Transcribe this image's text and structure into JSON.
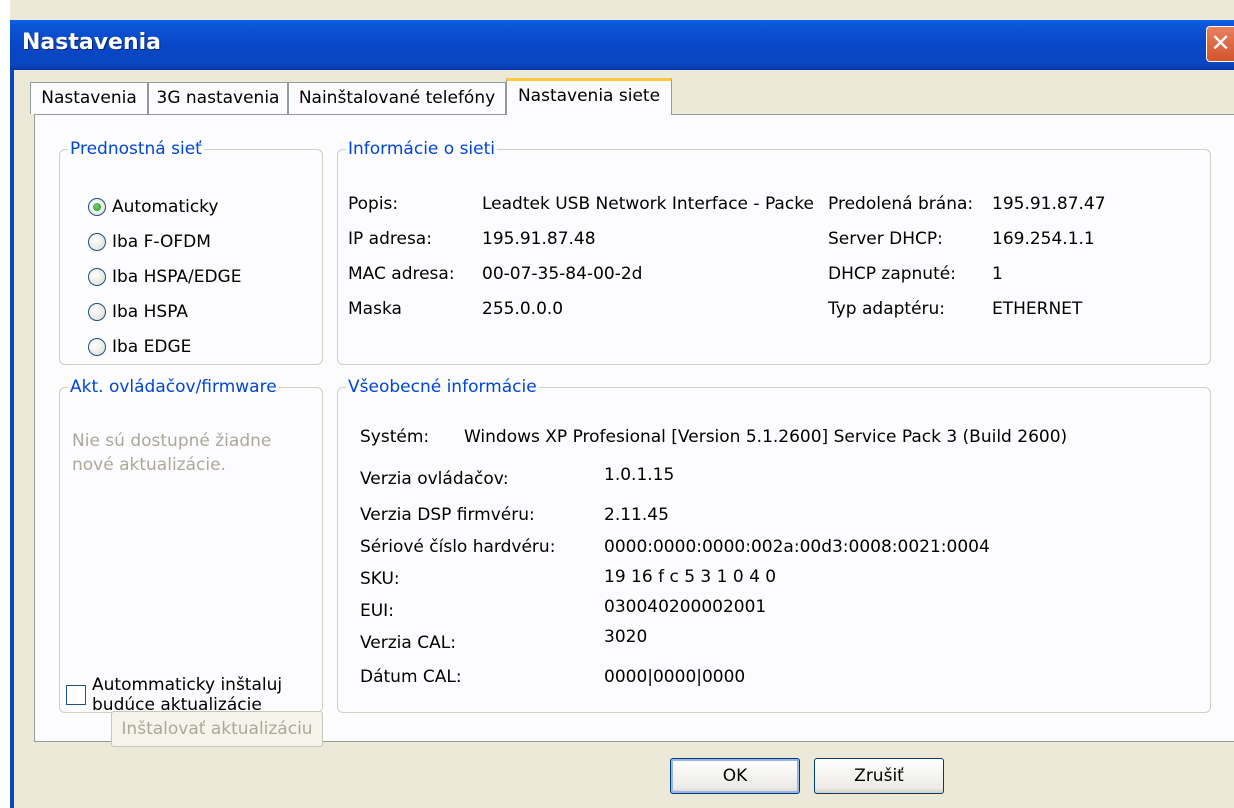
{
  "window": {
    "title": "Nastavenia"
  },
  "tabs": [
    {
      "label": "Nastavenia"
    },
    {
      "label": "3G nastavenia"
    },
    {
      "label": "Nainštalované telefóny"
    },
    {
      "label": "Nastavenia siete"
    }
  ],
  "preferred_network": {
    "legend": "Prednostná sieť",
    "selected": "Automaticky",
    "options": [
      "Automaticky",
      "Iba F-OFDM",
      "Iba HSPA/EDGE",
      "Iba HSPA",
      "Iba EDGE"
    ]
  },
  "network_info": {
    "legend": "Informácie o sieti",
    "left": [
      {
        "label": "Popis:",
        "value": "Leadtek USB Network Interface - Packe"
      },
      {
        "label": "IP adresa:",
        "value": "195.91.87.48"
      },
      {
        "label": "MAC adresa:",
        "value": "00-07-35-84-00-2d"
      },
      {
        "label": "Maska",
        "value": "255.0.0.0"
      }
    ],
    "right": [
      {
        "label": "Predolená brána:",
        "value": "195.91.87.47"
      },
      {
        "label": "Server DHCP:",
        "value": "169.254.1.1"
      },
      {
        "label": "DHCP zapnuté:",
        "value": "1"
      },
      {
        "label": "Typ adaptéru:",
        "value": "ETHERNET"
      }
    ]
  },
  "firmware": {
    "legend": "Akt. ovládačov/firmware",
    "status_line1": "Nie sú dostupné žiadne",
    "status_line2": "nové aktualizácie.",
    "install_button": "Inštalovať aktualizáciu",
    "auto_install_line1": "Autommaticky inštaluj",
    "auto_install_line2": "budúce aktualizácie",
    "auto_install_checked": false
  },
  "general_info": {
    "legend": "Všeobecné informácie",
    "system_label": "Systém:",
    "system_value": "Windows XP Profesional [Version 5.1.2600] Service Pack 3 (Build 2600)",
    "rows": [
      {
        "label": "Verzia ovládačov:",
        "value": "1.0.1.15"
      },
      {
        "label": "Verzia DSP firmvéru:",
        "value": "2.11.45"
      },
      {
        "label": "Sériové číslo hardvéru:",
        "value": "0000:0000:0000:002a:00d3:0008:0021:0004"
      },
      {
        "label": "SKU:",
        "value": "19 16 f c 5 3 1 0 4 0"
      },
      {
        "label": "EUI:",
        "value": "030040200002001"
      },
      {
        "label": "Verzia CAL:",
        "value": "3020"
      },
      {
        "label": "Dátum CAL:",
        "value": "0000|0000|0000"
      }
    ]
  },
  "buttons": {
    "ok": "OK",
    "cancel": "Zrušiť"
  }
}
